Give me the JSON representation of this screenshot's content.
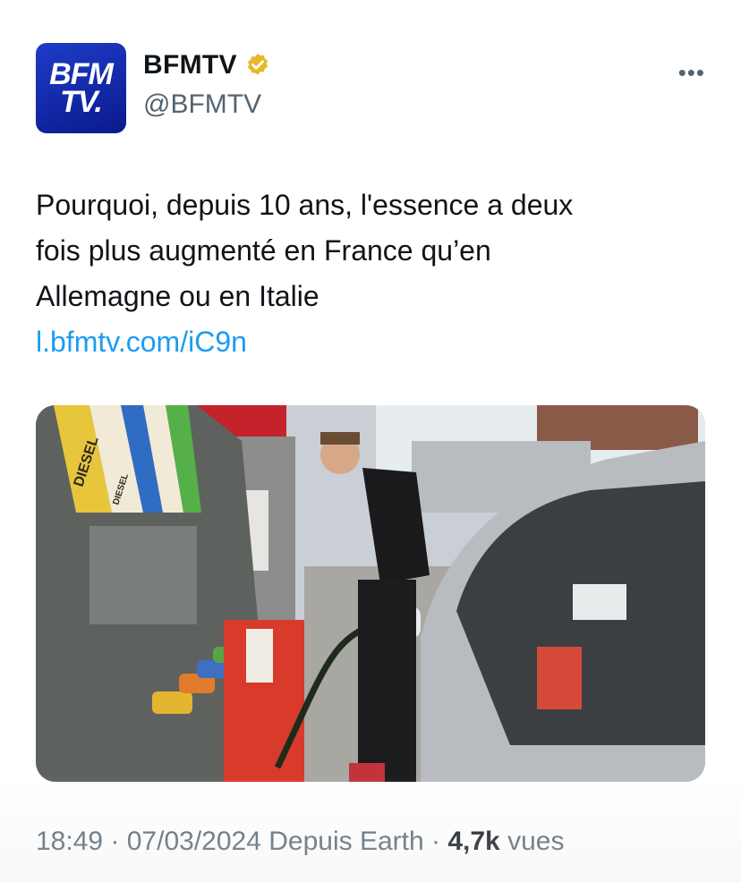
{
  "account": {
    "avatar_line1": "BFM",
    "avatar_line2": "TV.",
    "name": "BFMTV",
    "handle": "@BFMTV",
    "verified_color": "#e8b829",
    "more_icon": "more-icon"
  },
  "tweet": {
    "text_lines": [
      "Pourquoi, depuis 10 ans, l'essence a deux",
      "fois plus augmenté en France qu’en",
      "Allemagne ou en Italie"
    ],
    "link": "l.bfmtv.com/iC9n"
  },
  "media": {
    "pump_labels": [
      "DIESEL",
      "DIESEL"
    ]
  },
  "meta": {
    "time": "18:49",
    "sep1": " · ",
    "date": "07/03/2024",
    "source": " Depuis Earth",
    "sep2": " · ",
    "views_count": "4,7k",
    "views_label": " vues"
  },
  "colors": {
    "accent_link": "#1d9bf0",
    "avatar_bg": "#1e3cc8",
    "secondary_text": "#536471"
  }
}
